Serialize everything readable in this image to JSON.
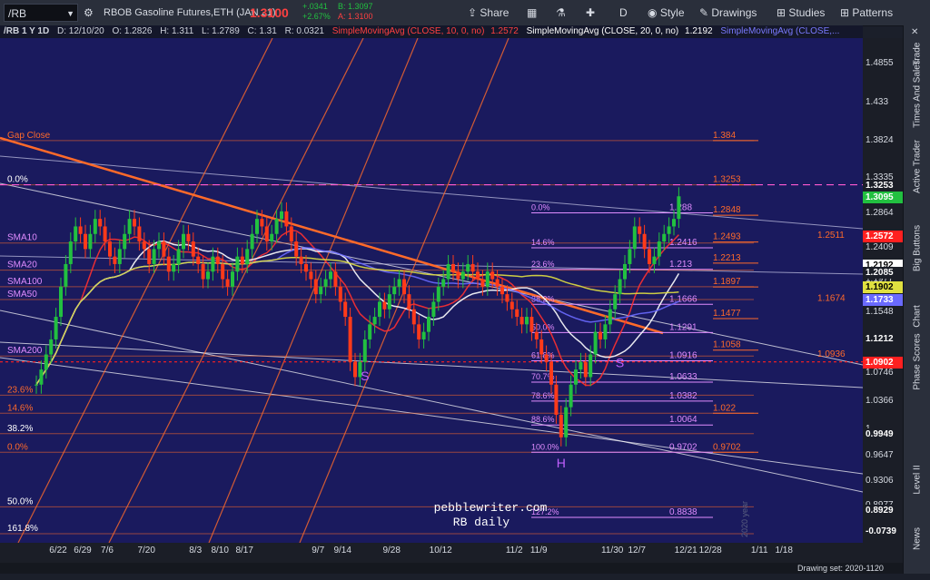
{
  "toolbar": {
    "symbol": "/RB",
    "description": "RBOB Gasoline Futures,ETH (JAN 21)",
    "last": "1.3100",
    "change": "+.0341",
    "change_pct": "+2.67%",
    "bid": "B: 1.3097",
    "ask": "A: 1.3100",
    "share": "Share",
    "period": "D",
    "style": "Style",
    "drawings": "Drawings",
    "studies": "Studies",
    "patterns": "Patterns"
  },
  "infobar": {
    "label": "/RB 1 Y 1D",
    "date": "D: 12/10/20",
    "open": "O: 1.2826",
    "high": "H: 1.311",
    "low": "L: 1.2789",
    "close": "C: 1.31",
    "range": "R: 0.0321",
    "sma10": "SimpleMovingAvg (CLOSE, 10, 0, no)",
    "sma10_val": "1.2572",
    "sma20": "SimpleMovingAvg (CLOSE, 20, 0, no)",
    "sma20_val": "1.2192",
    "sma50": "SimpleMovingAvg (CLOSE,..."
  },
  "side_tabs": [
    "Trade",
    "Times And Sales",
    "Active Trader",
    "Big Buttons",
    "Chart",
    "Phase Scores",
    "Level II",
    "News"
  ],
  "status": {
    "drawing_set": "Drawing set: 2020-1120",
    "watermark": "2020 year"
  },
  "colors": {
    "plot_bg": "#1a1a5e",
    "fib_orange": "#ff6a2a",
    "fib_magenta": "#e08cff",
    "sma10": "#ff3030",
    "sma20": "#ffffff",
    "sma50": "#6a6aff",
    "sma100": "#e0e040",
    "up": "#22c040",
    "down": "#ff3a1a"
  },
  "chart_data": {
    "type": "candlestick",
    "title": "pebblewriter.com",
    "subtitle": "RB daily",
    "x_ticks": [
      "6/22",
      "6/29",
      "7/6",
      "7/20",
      "8/3",
      "8/10",
      "8/17",
      "9/7",
      "9/14",
      "9/28",
      "10/12",
      "11/2",
      "11/9",
      "11/30",
      "12/7",
      "12/21",
      "12/28",
      "1/11",
      "1/18"
    ],
    "y_ticks": [
      1.4855,
      1.433,
      1.3824,
      1.3335,
      1.2864,
      1.2409,
      1.1977,
      1.1548,
      1.114,
      1.0746,
      1.0366,
      1.0,
      0.9647,
      0.9306,
      0.8977,
      0.866
    ],
    "ylim": [
      0.85,
      1.52
    ],
    "y_badges": [
      {
        "label": "1.3253",
        "value": 1.3253,
        "color": "#1b1e27",
        "text": "#ffffff"
      },
      {
        "label": "1.3095",
        "value": 1.3095,
        "color": "#22c040",
        "text": "#ffffff"
      },
      {
        "label": "1.2572",
        "value": 1.2572,
        "color": "#ff2020",
        "text": "#ffffff"
      },
      {
        "label": "1.2192",
        "value": 1.2192,
        "color": "#ffffff",
        "text": "#000000"
      },
      {
        "label": "1.2085",
        "value": 1.2085,
        "color": "#1b1e27",
        "text": "#ffffff"
      },
      {
        "label": "1.1902",
        "value": 1.1902,
        "color": "#e0e040",
        "text": "#000000"
      },
      {
        "label": "1.1733",
        "value": 1.1733,
        "color": "#6a6aff",
        "text": "#ffffff"
      },
      {
        "label": "1.1212",
        "value": 1.1212,
        "color": "#1b1e27",
        "text": "#ffffff"
      },
      {
        "label": "1.0902",
        "value": 1.0902,
        "color": "#ff2020",
        "text": "#ffffff"
      },
      {
        "label": "0.9949",
        "value": 0.9949,
        "color": "#1b1e27",
        "text": "#ffffff"
      },
      {
        "label": "0.8929",
        "value": 0.8929,
        "color": "#1b1e27",
        "text": "#ffffff"
      },
      {
        "label": "-0.0739",
        "value": 0.866,
        "color": "#1b1e27",
        "text": "#ffffff"
      }
    ],
    "fib_left": [
      {
        "label": "0.0%",
        "value": 1.3253
      },
      {
        "label": "38.2%",
        "value": 0.9949
      },
      {
        "label": "50.0%",
        "value": 0.8977
      },
      {
        "label": "161.8%",
        "value": 0.862
      }
    ],
    "fib_left_overlay": [
      {
        "label": "Gap Close",
        "value": 1.384
      },
      {
        "label": "SMA10",
        "value": 1.248
      },
      {
        "label": "SMA20",
        "value": 1.212
      },
      {
        "label": "SMA100",
        "value": 1.19
      },
      {
        "label": "SMA50",
        "value": 1.173
      },
      {
        "label": "SMA200",
        "value": 1.098
      },
      {
        "label": "23.6%",
        "value": 1.046
      },
      {
        "label": "14.6%",
        "value": 1.022
      },
      {
        "label": "0.0%",
        "value": 0.9702
      }
    ],
    "fib_mid": [
      {
        "label": "0.0%",
        "value": 1.288
      },
      {
        "label": "14.6%",
        "value": 1.2416
      },
      {
        "label": "23.6%",
        "value": 1.213
      },
      {
        "label": "38.2%",
        "value": 1.1666
      },
      {
        "label": "50.0%",
        "value": 1.1291
      },
      {
        "label": "61.8%",
        "value": 1.0916
      },
      {
        "label": "70.7%",
        "value": 1.0633
      },
      {
        "label": "78.6%",
        "value": 1.0382
      },
      {
        "label": "88.6%",
        "value": 1.0064
      },
      {
        "label": "100.0%",
        "value": 0.9702
      },
      {
        "label": "127.2%",
        "value": 0.8838
      }
    ],
    "fib_mid_values": [
      "1.288",
      "1.2416",
      "1.213",
      "1.1666",
      "1.1291",
      "1.0916",
      "1.0633",
      "1.0382",
      "1.0064",
      "0.9702",
      "0.8838"
    ],
    "fib_right": [
      {
        "label": "1.384",
        "value": 1.384
      },
      {
        "label": "1.3253",
        "value": 1.3253
      },
      {
        "label": "1.2848",
        "value": 1.2848
      },
      {
        "label": "1.2493",
        "value": 1.2493
      },
      {
        "label": "1.2213",
        "value": 1.2213
      },
      {
        "label": "1.1897",
        "value": 1.1897
      },
      {
        "label": "1.1477",
        "value": 1.1477
      },
      {
        "label": "1.1058",
        "value": 1.1058
      },
      {
        "label": "1.022",
        "value": 1.022
      },
      {
        "label": "0.9702",
        "value": 0.9702
      }
    ],
    "fib_right2": [
      {
        "label": "1.2511",
        "value": 1.2511
      },
      {
        "label": "1.1674",
        "value": 1.1674
      },
      {
        "label": "1.0936",
        "value": 1.0936
      }
    ],
    "pattern_labels": [
      {
        "label": "S",
        "date_index": 67,
        "value": 1.066
      },
      {
        "label": "H",
        "date_index": 107,
        "value": 0.95
      },
      {
        "label": "S",
        "date_index": 119,
        "value": 1.083
      }
    ],
    "closes": [
      1.06,
      1.08,
      1.1,
      1.12,
      1.15,
      1.19,
      1.22,
      1.25,
      1.27,
      1.26,
      1.24,
      1.26,
      1.28,
      1.27,
      1.25,
      1.23,
      1.22,
      1.24,
      1.26,
      1.28,
      1.27,
      1.25,
      1.24,
      1.22,
      1.24,
      1.25,
      1.23,
      1.21,
      1.22,
      1.24,
      1.26,
      1.25,
      1.23,
      1.22,
      1.2,
      1.21,
      1.23,
      1.22,
      1.2,
      1.19,
      1.21,
      1.23,
      1.22,
      1.24,
      1.26,
      1.28,
      1.27,
      1.25,
      1.26,
      1.28,
      1.29,
      1.27,
      1.25,
      1.23,
      1.22,
      1.21,
      1.2,
      1.18,
      1.19,
      1.2,
      1.21,
      1.19,
      1.17,
      1.15,
      1.09,
      1.07,
      1.09,
      1.12,
      1.14,
      1.15,
      1.17,
      1.16,
      1.18,
      1.19,
      1.2,
      1.18,
      1.16,
      1.14,
      1.12,
      1.13,
      1.15,
      1.17,
      1.19,
      1.2,
      1.22,
      1.21,
      1.2,
      1.21,
      1.22,
      1.21,
      1.2,
      1.19,
      1.21,
      1.2,
      1.19,
      1.18,
      1.17,
      1.16,
      1.15,
      1.14,
      1.15,
      1.13,
      1.12,
      1.1,
      1.09,
      1.06,
      1.02,
      0.99,
      1.03,
      1.06,
      1.08,
      1.09,
      1.07,
      1.1,
      1.13,
      1.12,
      1.14,
      1.16,
      1.18,
      1.2,
      1.22,
      1.24,
      1.27,
      1.26,
      1.24,
      1.22,
      1.23,
      1.25,
      1.26,
      1.27,
      1.28,
      1.31
    ]
  }
}
